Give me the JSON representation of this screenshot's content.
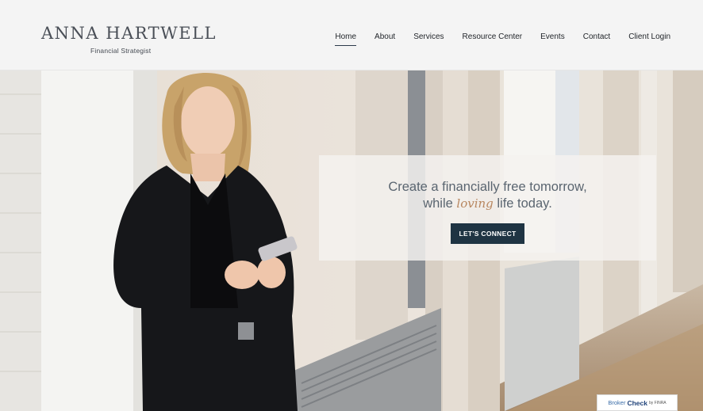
{
  "brand": {
    "name": "ANNA HARTWELL",
    "tagline": "Financial Strategist"
  },
  "nav": {
    "items": [
      {
        "label": "Home",
        "active": true
      },
      {
        "label": "About"
      },
      {
        "label": "Services"
      },
      {
        "label": "Resource Center"
      },
      {
        "label": "Events"
      },
      {
        "label": "Contact"
      },
      {
        "label": "Client Login"
      }
    ]
  },
  "hero": {
    "headline_line1": "Create a financially free tomorrow,",
    "headline_pre": "while",
    "headline_accent": "loving",
    "headline_post": "life today.",
    "cta_label": "LET'S CONNECT"
  },
  "badge": {
    "brand": "Broker",
    "check": "Check",
    "by": "by FINRA"
  },
  "colors": {
    "accent": "#b88760",
    "button_bg": "#1f3443",
    "text_muted": "#5a6570"
  }
}
